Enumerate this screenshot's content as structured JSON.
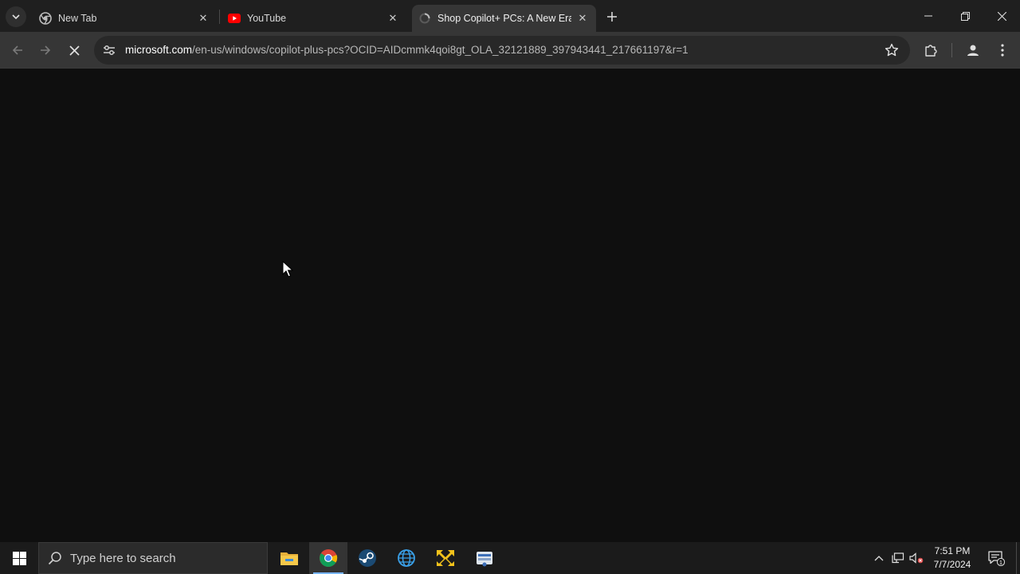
{
  "browser": {
    "tabs": [
      {
        "title": "New Tab",
        "icon": "chrome-icon"
      },
      {
        "title": "YouTube",
        "icon": "youtube-icon"
      },
      {
        "title": "Shop Copilot+ PCs: A New Era",
        "icon": "loading-icon"
      }
    ],
    "active_tab_index": 2,
    "address": {
      "host": "microsoft.com",
      "path": "/en-us/windows/copilot-plus-pcs?OCID=AIDcmmk4qoi8gt_OLA_32121889_397943441_217661197&r=1"
    }
  },
  "taskbar": {
    "search_placeholder": "Type here to search",
    "pinned_apps": [
      "file-explorer-icon",
      "chrome-icon",
      "steam-icon",
      "globe-icon",
      "yellow-arrows-icon",
      "disk-app-icon"
    ],
    "active_app": "chrome-icon",
    "clock": {
      "time": "7:51 PM",
      "date": "7/7/2024"
    },
    "notification_count": "1"
  },
  "colors": {
    "page_background": "#0f0f0f",
    "toolbar": "#363636",
    "tabstrip": "#1f1f1f",
    "taskbar": "#1b1b1b",
    "accent": "#78b5ff"
  }
}
